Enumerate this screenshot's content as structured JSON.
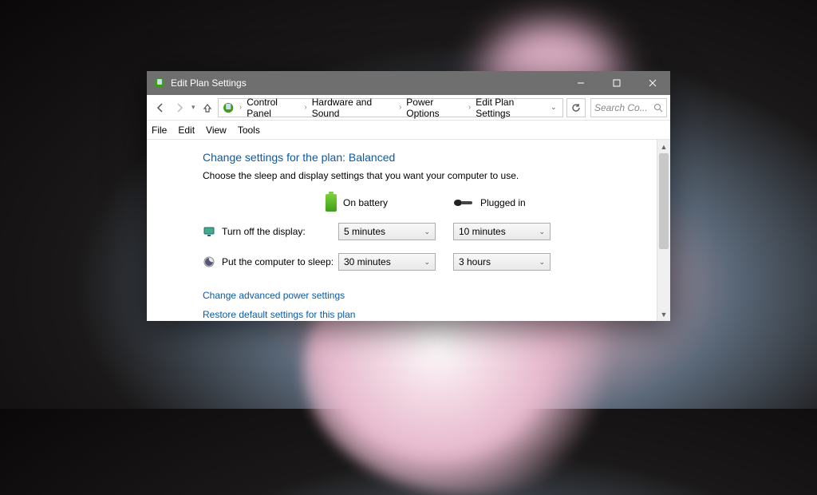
{
  "window": {
    "title": "Edit Plan Settings"
  },
  "breadcrumb": {
    "items": [
      "Control Panel",
      "Hardware and Sound",
      "Power Options",
      "Edit Plan Settings"
    ]
  },
  "search": {
    "placeholder": "Search Co..."
  },
  "menubar": {
    "items": [
      "File",
      "Edit",
      "View",
      "Tools"
    ]
  },
  "main": {
    "heading": "Change settings for the plan: Balanced",
    "subtext": "Choose the sleep and display settings that you want your computer to use.",
    "columns": {
      "battery": "On battery",
      "plugged": "Plugged in"
    },
    "rows": {
      "display": {
        "label": "Turn off the display:",
        "battery": "5 minutes",
        "plugged": "10 minutes"
      },
      "sleep": {
        "label": "Put the computer to sleep:",
        "battery": "30 minutes",
        "plugged": "3 hours"
      }
    },
    "links": {
      "advanced": "Change advanced power settings",
      "restore": "Restore default settings for this plan"
    }
  }
}
